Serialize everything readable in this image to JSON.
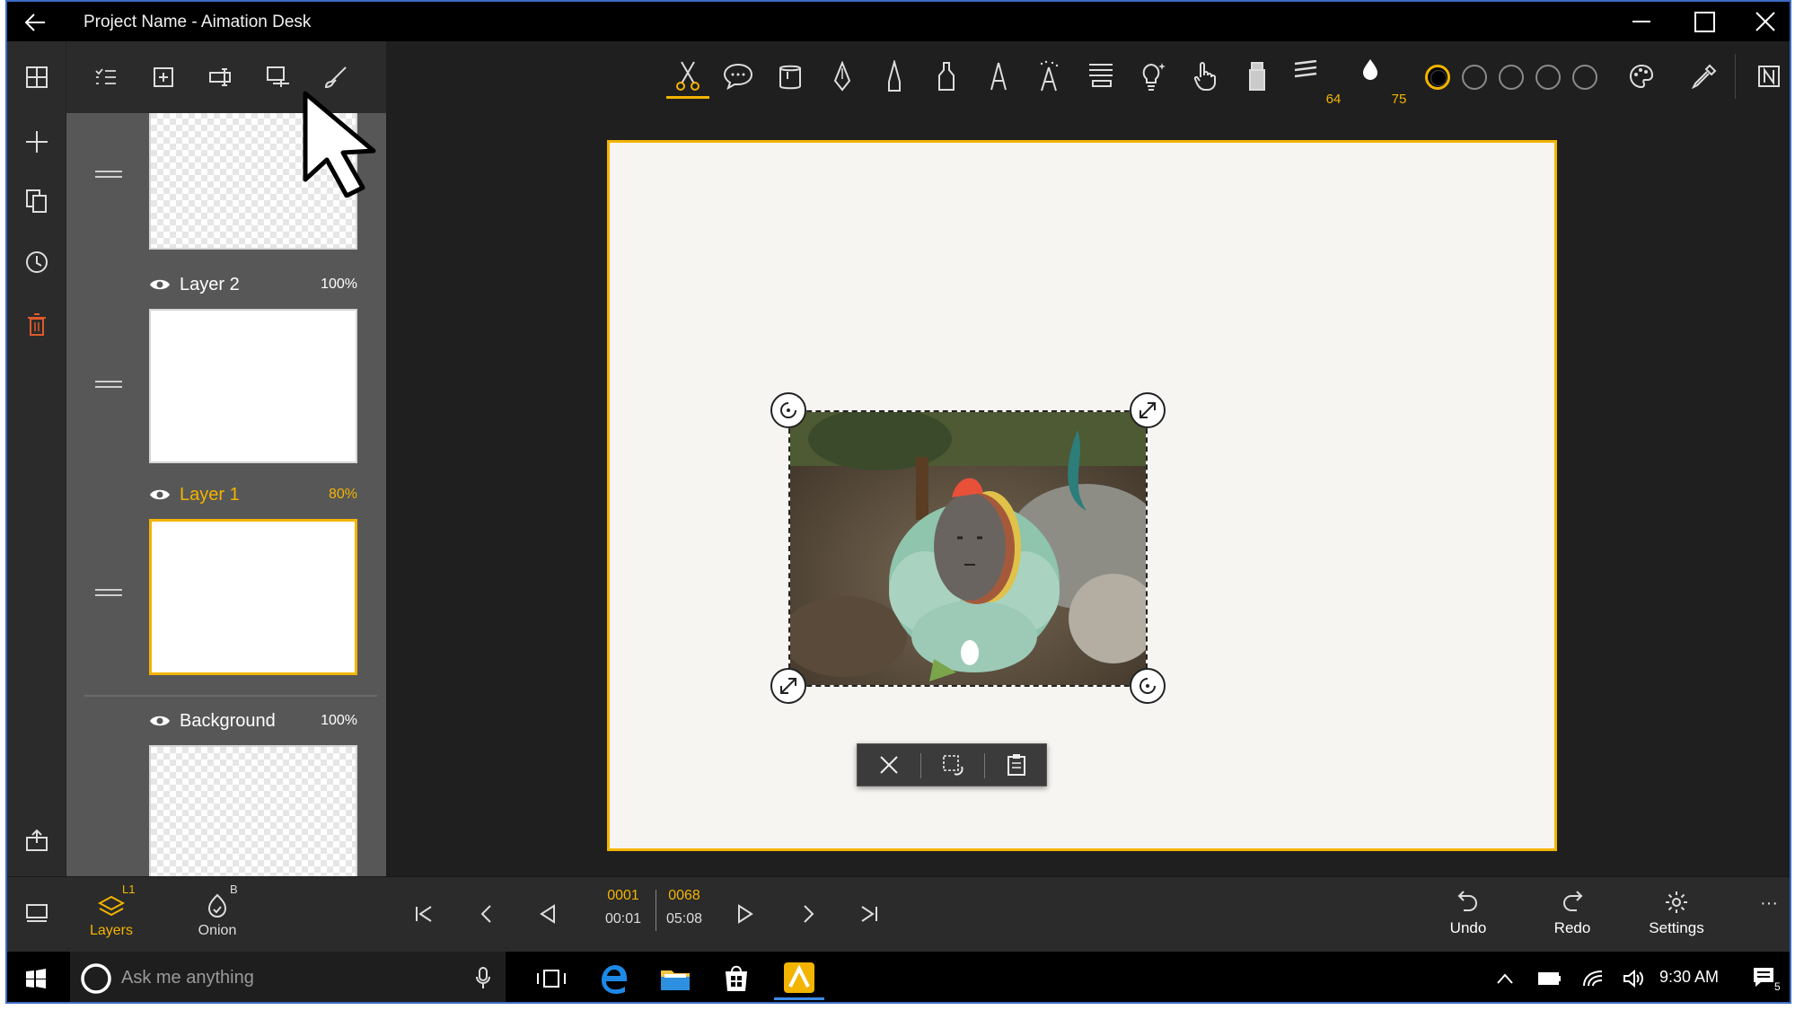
{
  "window": {
    "title": "Project Name - Aimation Desk"
  },
  "layers": [
    {
      "name": "Layer 2",
      "opacity": "100%"
    },
    {
      "name": "Layer 1",
      "opacity": "80%"
    },
    {
      "name": "Background",
      "opacity": "100%"
    }
  ],
  "toolbar": {
    "brush_size": "64",
    "opacity": "75"
  },
  "bottom_tabs": {
    "layers_label": "Layers",
    "layers_sup": "L1",
    "onion_label": "Onion",
    "onion_sup": "B"
  },
  "timeline": {
    "current_frame": "0001",
    "current_time": "00:01",
    "total_frames": "0068",
    "total_time": "05:08"
  },
  "actions": {
    "undo": "Undo",
    "redo": "Redo",
    "settings": "Settings",
    "more": "···"
  },
  "taskbar": {
    "search_placeholder": "Ask me anything",
    "time": "9:30 AM",
    "notification_count": "5"
  },
  "colors": {
    "accent": "#f3b400",
    "panel": "#575757",
    "background": "#1f1f1f",
    "danger": "#e05a2b"
  }
}
